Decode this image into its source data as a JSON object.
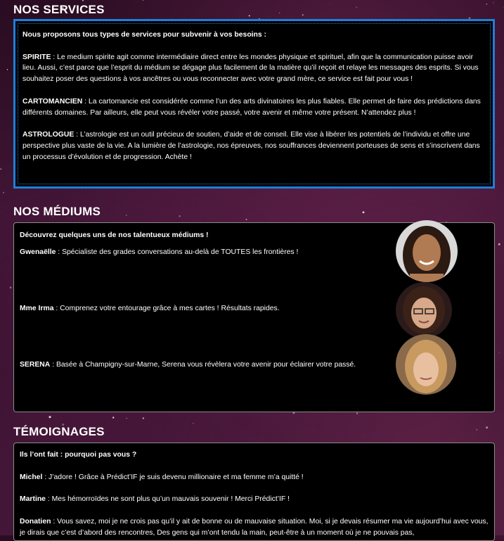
{
  "services": {
    "title": "NOS SERVICES",
    "intro": "Nous proposons tous types de services pour subvenir à vos besoins :",
    "items": [
      {
        "name": "SPIRITE",
        "text": " : Le medium spirite agit comme intermédiaire direct entre les mondes physique et spirituel, afin que la communication puisse avoir lieu. Aussi, c’est parce que l’esprit du médium se dégage plus facilement de la matière qu’il reçoit et relaye les messages des esprits. Si vous souhaitez poser des questions à vos ancêtres ou vous reconnecter avec votre grand mère, ce service est fait pour vous !"
      },
      {
        "name": "CARTOMANCIEN",
        "text": " : La cartomancie est considérée comme l’un des arts divinatoires les plus fiables. Elle permet de faire des prédictions dans différents domaines. Par ailleurs, elle peut vous révéler votre passé, votre avenir et même votre présent. N’attendez plus !"
      },
      {
        "name": "ASTROLOGUE",
        "text": " : L’astrologie est un outil précieux de soutien, d’aide et de conseil. Elle vise à libérer les potentiels de l’individu et offre une perspective plus vaste de la vie. A la lumière de l’astrologie, nos épreuves, nos souffrances deviennent porteuses de sens et s’inscrivent dans un processus d’évolution et de progression. Achète !"
      }
    ]
  },
  "mediums": {
    "title": "NOS MÉDIUMS",
    "intro": "Découvrez quelques uns de nos talentueux médiums !",
    "items": [
      {
        "name": "Gwenaëlle",
        "text": " : Spécialiste des grades conversations au-delà de TOUTES les frontières !",
        "avatar": "woman-portrait-1"
      },
      {
        "name": "Mme Irma",
        "text": " : Comprenez votre entourage grâce à mes cartes ! Résultats rapides.",
        "avatar": "woman-portrait-2"
      },
      {
        "name": "SERENA",
        "text": " : Basée à Champigny-sur-Marne, Serena vous révèlera votre avenir pour éclairer votre passé.",
        "avatar": "woman-portrait-3"
      }
    ]
  },
  "temoignages": {
    "title": "TÉMOIGNAGES",
    "intro": "Ils l’ont fait : pourquoi pas vous ?",
    "items": [
      {
        "name": "Michel",
        "text": " : J’adore ! Grâce à Prédict’IF je suis devenu millionaire et ma femme m’a quitté !"
      },
      {
        "name": "Martine",
        "text": " : Mes hémorroïdes ne sont plus qu’un mauvais souvenir ! Merci Prédict’IF !"
      },
      {
        "name": "Donatien",
        "text": " : Vous savez, moi je ne crois pas qu’il y ait de bonne ou de mauvaise situation. Moi, si je devais résumer ma vie aujourd’hui avec vous, je dirais que c’est d’abord des rencontres, Des gens qui m’ont tendu la main, peut-être à un moment où je ne pouvais pas,"
      }
    ]
  },
  "colors": {
    "accent": "#1f7fd6",
    "panel": "#000000",
    "border": "#8c8c8c"
  }
}
